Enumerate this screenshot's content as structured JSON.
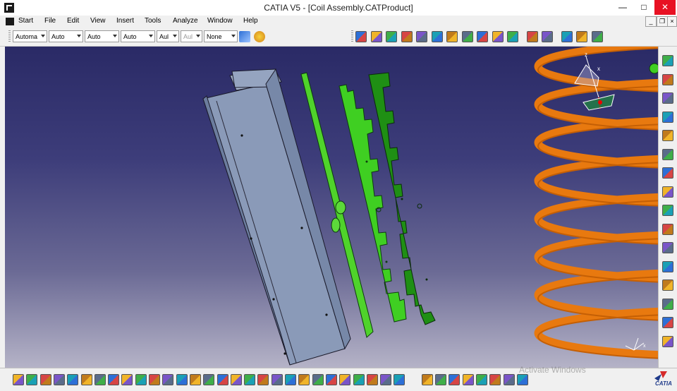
{
  "window": {
    "title": "CATIA V5 - [Coil Assembly.CATProduct]"
  },
  "menu": [
    "Start",
    "File",
    "Edit",
    "View",
    "Insert",
    "Tools",
    "Analyze",
    "Window",
    "Help"
  ],
  "toolbar_top": {
    "combos": [
      "Automa",
      "Auto",
      "Auto",
      "Auto",
      "Aul",
      "Aul",
      "None"
    ]
  },
  "watermark": "Activate Windows",
  "logo": "CATIA",
  "icons": {
    "top": [
      "painter-icon",
      "material-icon",
      "paint-icon",
      "shading-icon",
      "normal-icon",
      "measure-icon",
      "graph-icon",
      "swap-icon",
      "explode-icon",
      "constraint-icon",
      "manipulate-icon",
      "snap-icon",
      "fix-icon",
      "product-icon",
      "component-icon",
      "part-icon"
    ],
    "right": [
      "sketcher-icon",
      "select-arrow-icon",
      "clash-icon",
      "new-component-icon",
      "new-product-icon",
      "new-part-icon",
      "existing-component-icon",
      "replace-icon",
      "graph-tree-icon",
      "generate-numbering-icon",
      "multi-instantiation-icon",
      "reuse-pattern-icon",
      "scene-icon",
      "catalog-icon",
      "smart-move-icon",
      "constraint-icon"
    ],
    "bottom": [
      "new-icon",
      "open-icon",
      "save-icon",
      "print-icon",
      "cut-icon",
      "copy-icon",
      "paste-icon",
      "undo-icon",
      "redo-icon",
      "whats-this-icon",
      "formula-icon",
      "comment-icon",
      "light-icon",
      "table-icon",
      "tree-icon",
      "catalog-icon",
      "knowledge-icon",
      "fly-icon",
      "fit-all-icon",
      "pan-icon",
      "rotate-icon",
      "zoom-in-icon",
      "zoom-out-icon",
      "normal-view-icon",
      "multi-view-icon",
      "iso-view-icon",
      "render-style-icon",
      "hide-show-icon",
      "swap-space-icon",
      "capture-icon",
      "analysis-icon",
      "update-icon",
      "axis-icon",
      "scene-icon",
      "compass-icon",
      "keep-icon",
      "sync-icon"
    ]
  }
}
